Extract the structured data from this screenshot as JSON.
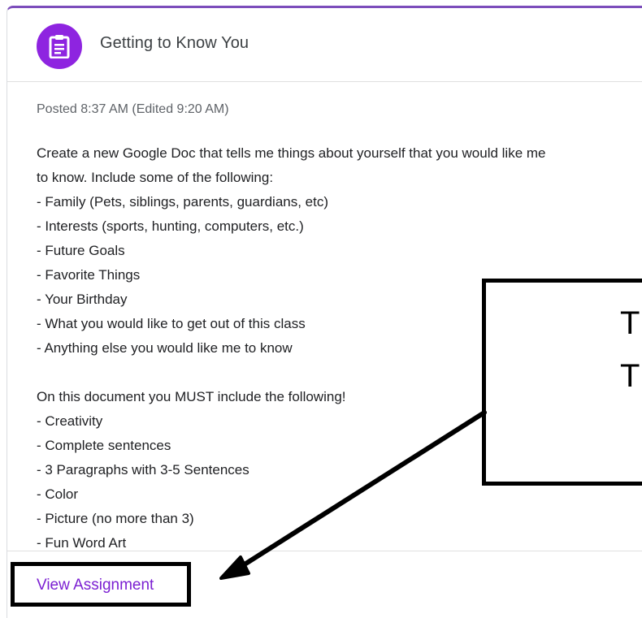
{
  "assignment": {
    "title": "Getting to Know You",
    "icon": "assignment-icon",
    "posted": "Posted 8:37 AM (Edited 9:20 AM)",
    "description_lines": [
      "Create a new Google Doc that tells me things about yourself that you would like me",
      "to know. Include some of the following:",
      "- Family (Pets, siblings, parents, guardians, etc)",
      "- Interests (sports, hunting, computers, etc.)",
      "- Future Goals",
      "- Favorite Things",
      "- Your Birthday",
      "- What you would like to get out of this class",
      "- Anything else you would like me to know",
      "",
      "On this document you MUST include the following!",
      "- Creativity",
      "- Complete sentences",
      "- 3 Paragraphs with 3-5 Sentences",
      "- Color",
      "- Picture (no more than 3)",
      "- Fun Word Art"
    ],
    "view_link": "View Assignment"
  },
  "callout": {
    "line1": "T",
    "line2": "T"
  },
  "colors": {
    "accent": "#8e24e0",
    "link": "#7b1fd2",
    "header_border": "#7c4dbb",
    "annotation": "#000000"
  }
}
